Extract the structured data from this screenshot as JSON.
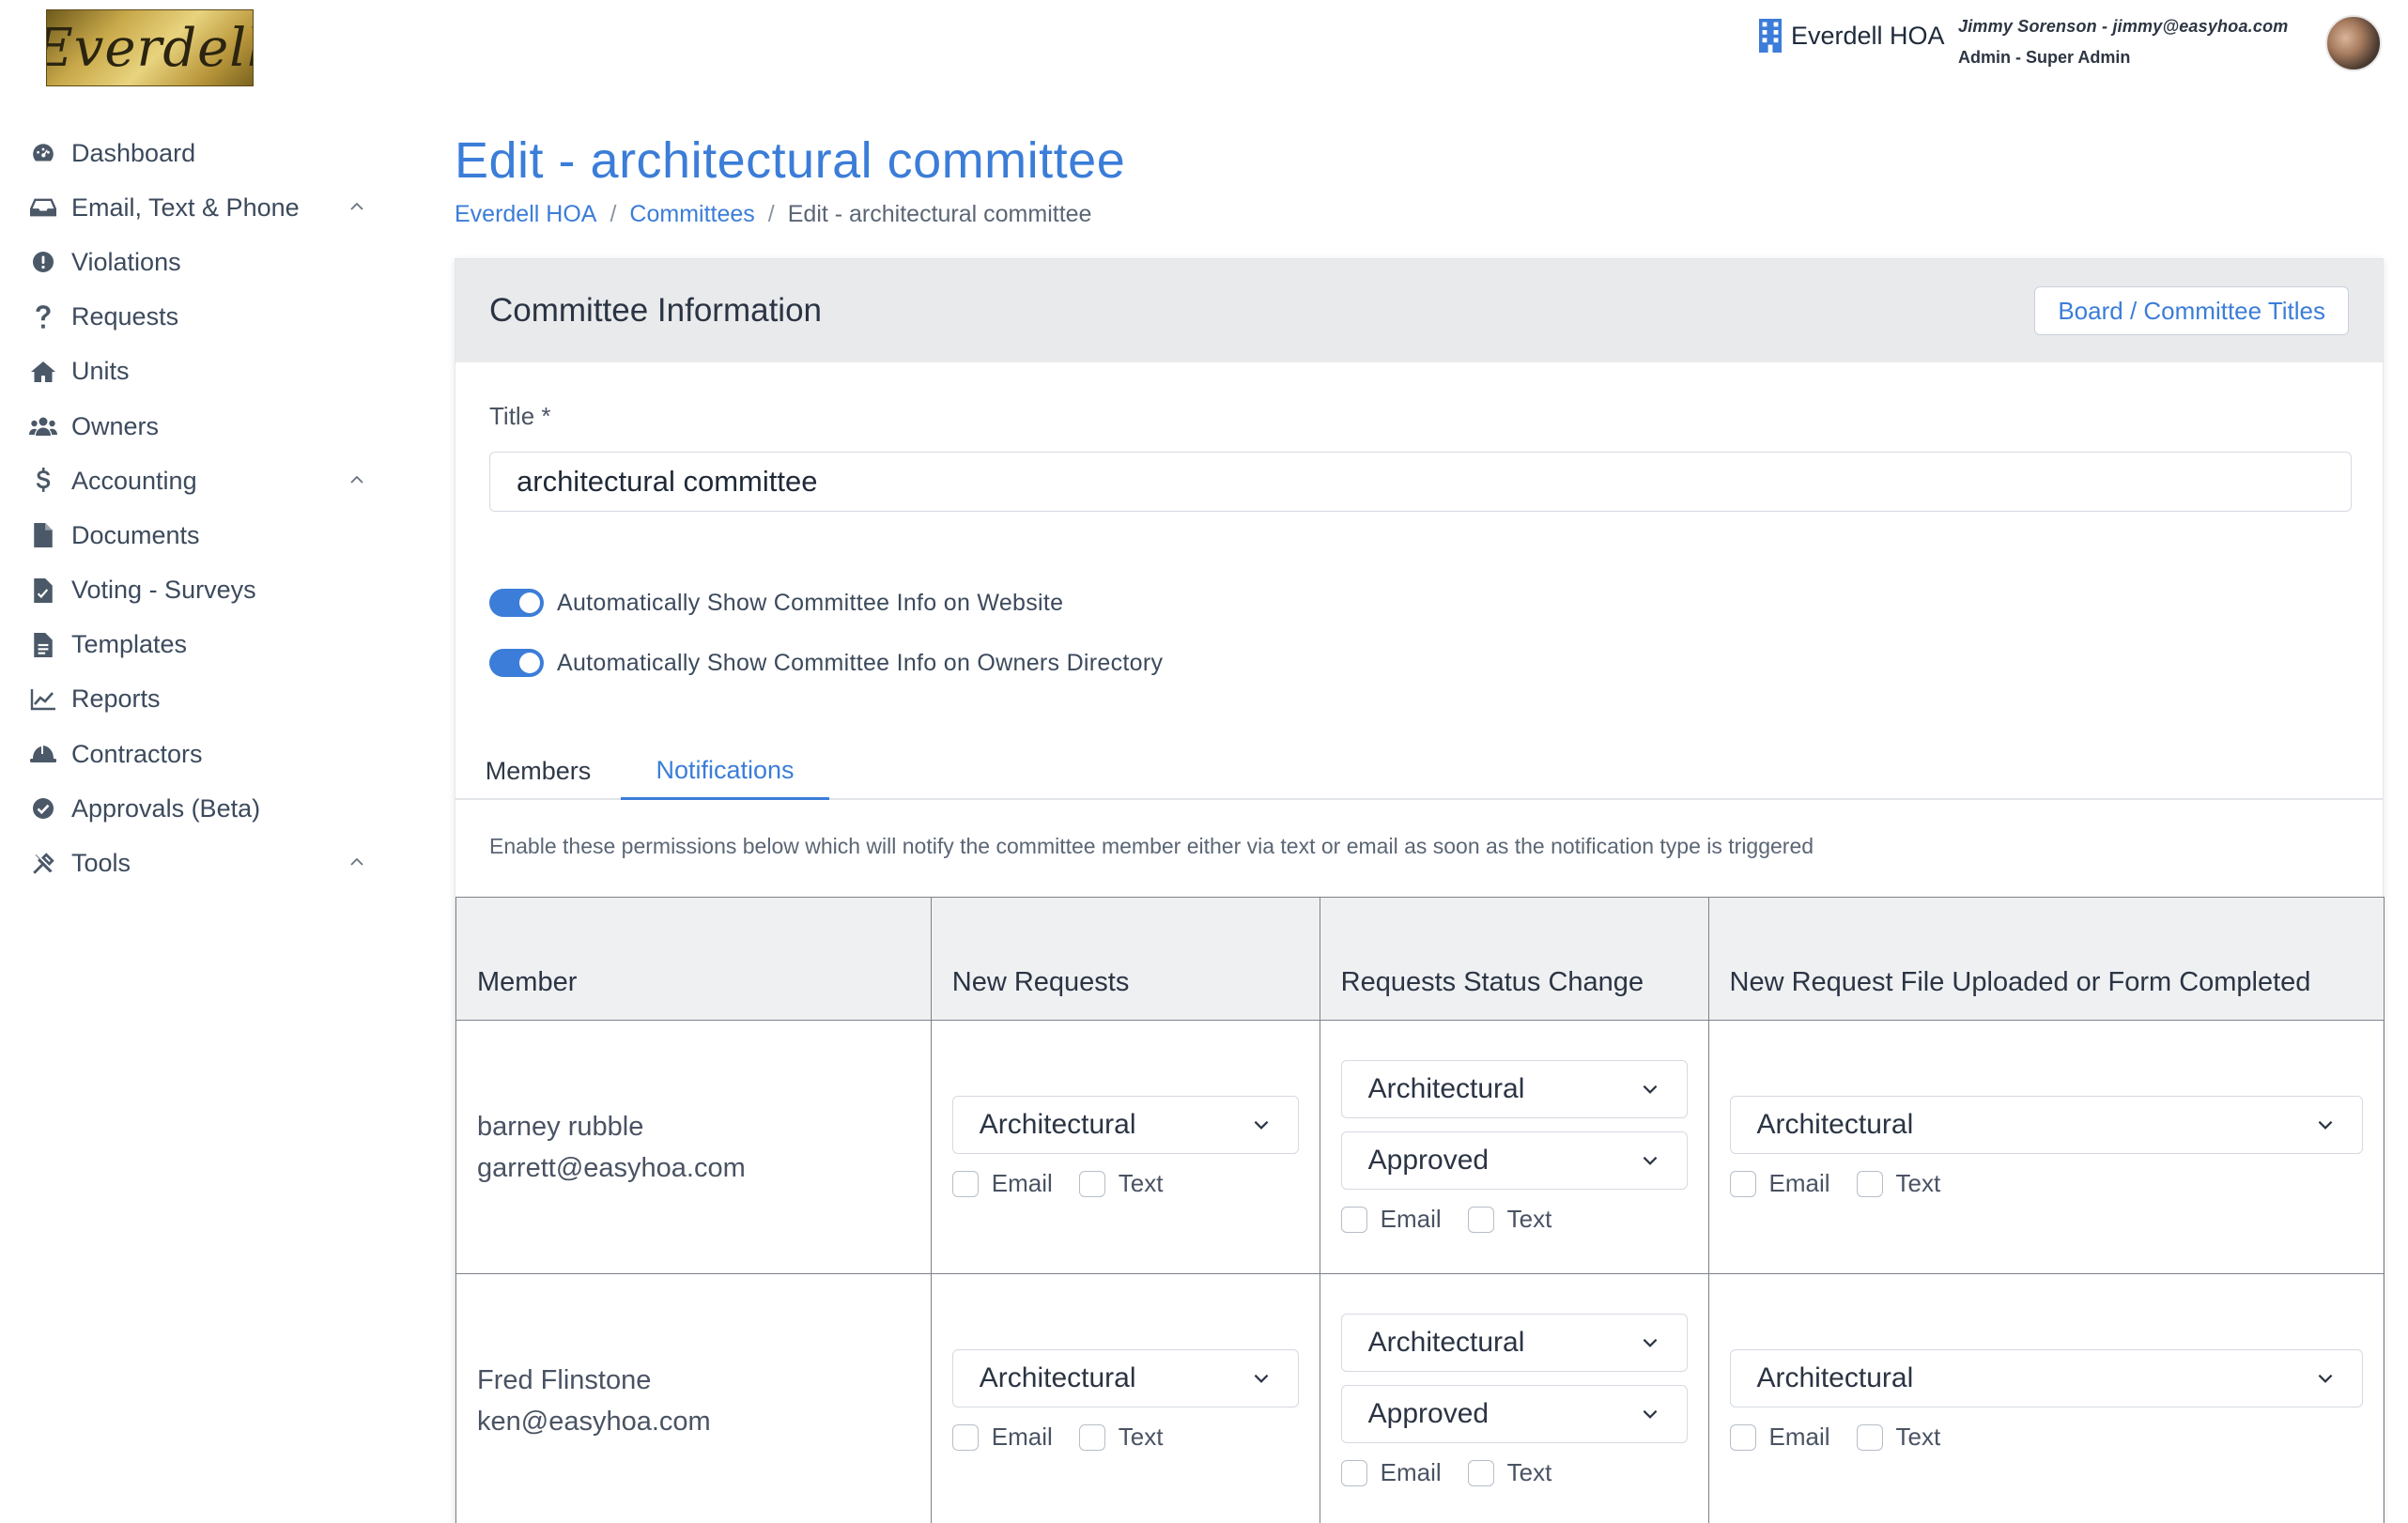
{
  "logo": {
    "text": "Everdell"
  },
  "sidebar": {
    "items": [
      {
        "label": "Dashboard",
        "icon": "dashboard-icon",
        "expandable": false
      },
      {
        "label": "Email, Text & Phone",
        "icon": "inbox-icon",
        "expandable": true
      },
      {
        "label": "Violations",
        "icon": "alert-icon",
        "expandable": false
      },
      {
        "label": "Requests",
        "icon": "question-icon",
        "expandable": false
      },
      {
        "label": "Units",
        "icon": "home-icon",
        "expandable": false
      },
      {
        "label": "Owners",
        "icon": "users-icon",
        "expandable": false
      },
      {
        "label": "Accounting",
        "icon": "dollar-icon",
        "expandable": true
      },
      {
        "label": "Documents",
        "icon": "document-icon",
        "expandable": false
      },
      {
        "label": "Voting - Surveys",
        "icon": "vote-icon",
        "expandable": false
      },
      {
        "label": "Templates",
        "icon": "template-icon",
        "expandable": false
      },
      {
        "label": "Reports",
        "icon": "chart-icon",
        "expandable": false
      },
      {
        "label": "Contractors",
        "icon": "hardhat-icon",
        "expandable": false
      },
      {
        "label": "Approvals (Beta)",
        "icon": "check-circle-icon",
        "expandable": false
      },
      {
        "label": "Tools",
        "icon": "tools-icon",
        "expandable": true
      }
    ]
  },
  "header": {
    "org_name": "Everdell HOA",
    "user_line1": "Jimmy Sorenson - jimmy@easyhoa.com",
    "user_line2": "Admin - Super Admin"
  },
  "page": {
    "title": "Edit - architectural committee",
    "breadcrumb": {
      "home": "Everdell HOA",
      "section": "Committees",
      "current": "Edit - architectural committee",
      "separator": "/"
    }
  },
  "card": {
    "title": "Committee Information",
    "titles_button": "Board / Committee Titles",
    "title_label": "Title *",
    "title_value": "architectural committee",
    "toggle_website": "Automatically Show Committee Info on Website",
    "toggle_directory": "Automatically Show Committee Info on Owners Directory",
    "tabs": {
      "members": "Members",
      "notifications": "Notifications"
    },
    "description": "Enable these permissions below which will notify the committee member either via text or email as soon as the notification type is triggered"
  },
  "table": {
    "headers": {
      "member": "Member",
      "new_requests": "New Requests",
      "status_change": "Requests Status Change",
      "file_uploaded": "New Request File Uploaded or Form Completed"
    },
    "email_label": "Email",
    "text_label": "Text",
    "rows": [
      {
        "name": "barney rubble",
        "email": "garrett@easyhoa.com",
        "new_requests_type": "Architectural",
        "status_type": "Architectural",
        "status_value": "Approved",
        "file_type": "Architectural"
      },
      {
        "name": "Fred Flinstone",
        "email": "ken@easyhoa.com",
        "new_requests_type": "Architectural",
        "status_type": "Architectural",
        "status_value": "Approved",
        "file_type": "Architectural"
      }
    ]
  },
  "colors": {
    "accent": "#3b7dd8",
    "header_bg": "#e9eaec",
    "text": "#3c4a5c"
  }
}
